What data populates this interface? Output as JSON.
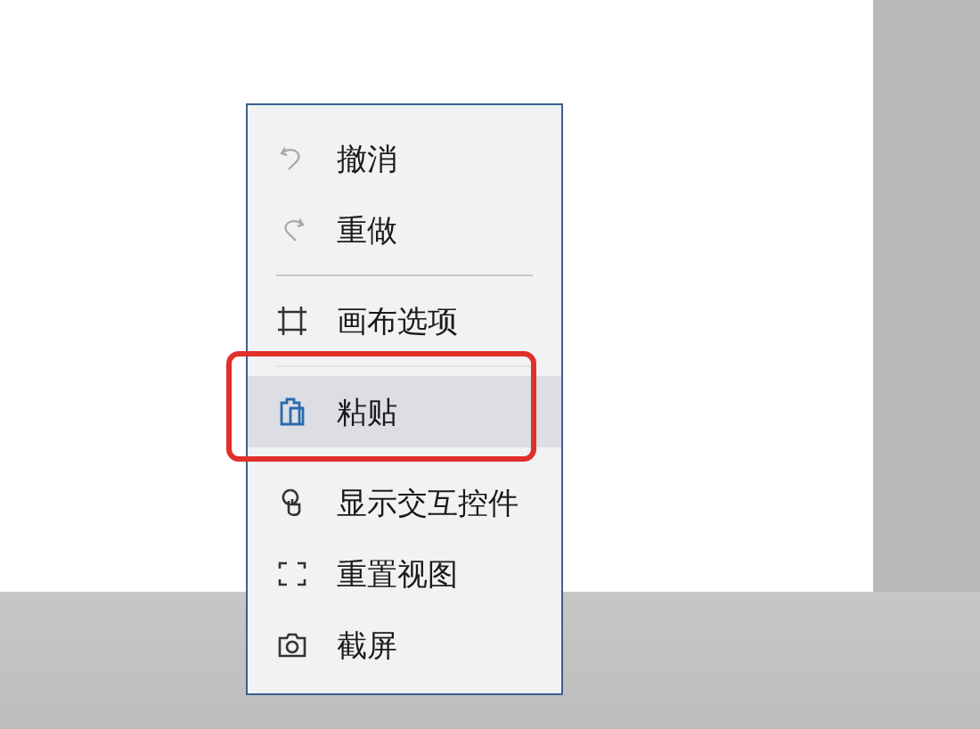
{
  "menu": {
    "groups": [
      {
        "items": [
          {
            "label": "撤消",
            "selected": false
          },
          {
            "label": "重做",
            "selected": false
          }
        ]
      },
      {
        "items": [
          {
            "label": "画布选项",
            "selected": false
          }
        ]
      },
      {
        "items": [
          {
            "label": "粘贴",
            "selected": true
          }
        ]
      },
      {
        "items": [
          {
            "label": "显示交互控件",
            "selected": false
          },
          {
            "label": "重置视图",
            "selected": false
          },
          {
            "label": "截屏",
            "selected": false
          }
        ]
      }
    ]
  }
}
